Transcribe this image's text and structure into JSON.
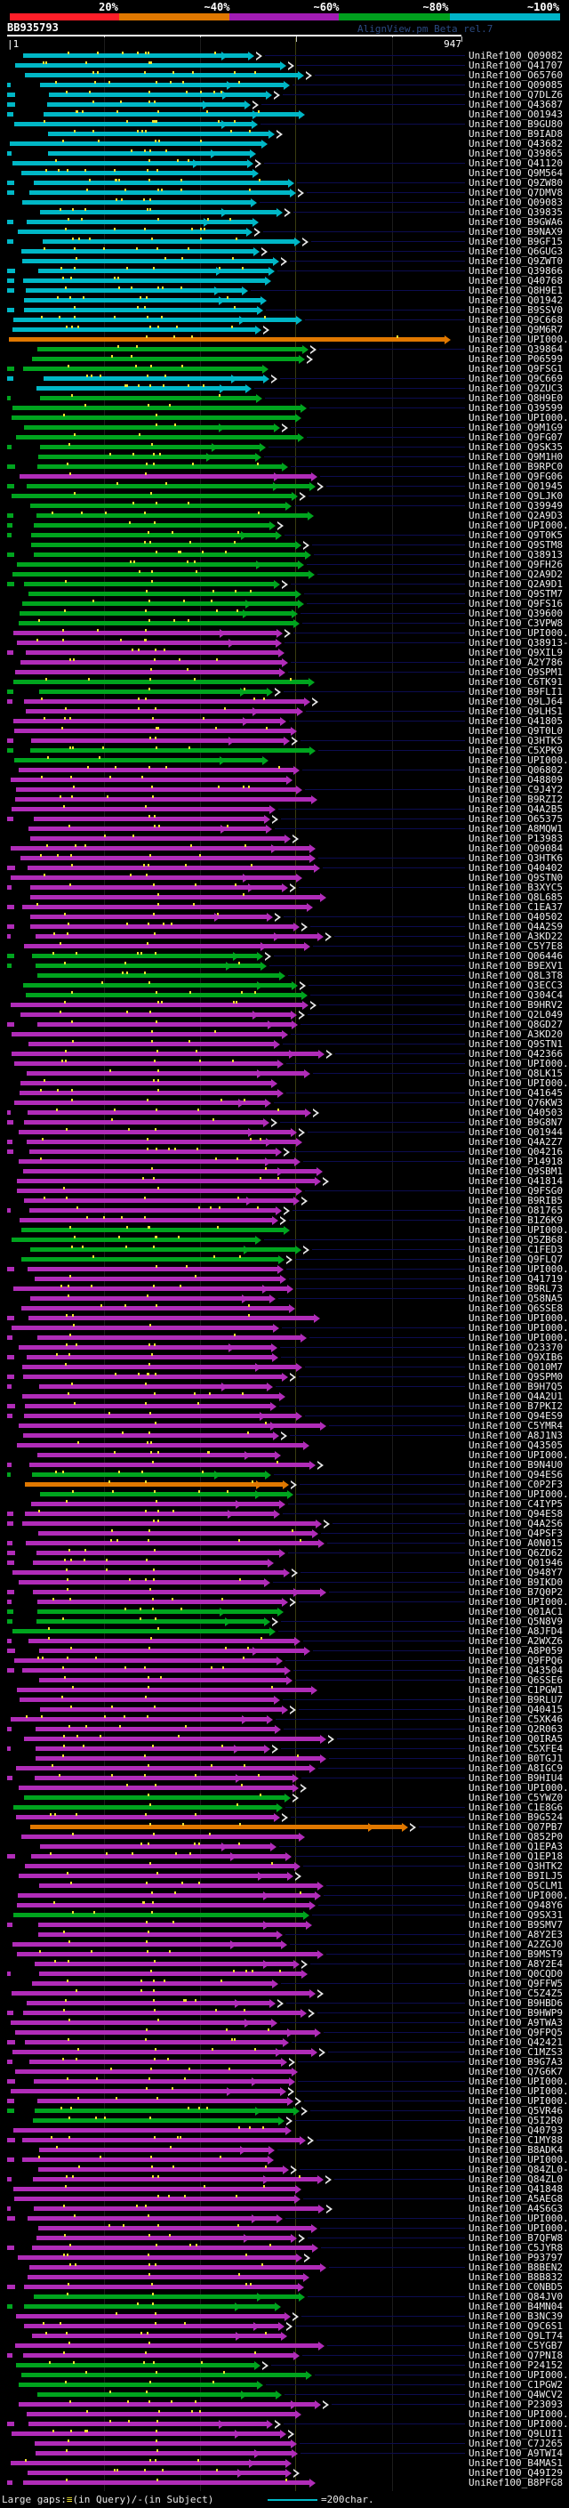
{
  "header": {
    "title": "BB935793",
    "app_label": "AlignView.pm Beta rel.7",
    "query_start_label": "|1",
    "query_end_label": "947"
  },
  "legend": {
    "prefix": "Large gaps:",
    "gap_glyph": "≡",
    "suffix": "(in Query)/-(in Subject)",
    "scalebar_label": "=200char."
  },
  "chart_data": {
    "type": "alignment-map",
    "query": {
      "name": "BB935793",
      "length": 947,
      "start": 1
    },
    "scale": {
      "labels": [
        "20%",
        "~40%",
        "~60%",
        "~80%",
        "~100%"
      ],
      "colors": [
        "#ff1e28",
        "#e07800",
        "#a21cb4",
        "#00a01e",
        "#00b4c8"
      ]
    },
    "bucket_legend": {
      "c": "~100%",
      "g": "~80%",
      "m": "~60%",
      "o": "~40%"
    },
    "hits": [
      [
        "UniRef100_Q09082",
        "c"
      ],
      [
        "UniRef100_Q41707",
        "c"
      ],
      [
        "UniRef100_O65760",
        "c"
      ],
      [
        "UniRef100_Q09085",
        "c"
      ],
      [
        "UniRef100_Q7DLZ6",
        "c"
      ],
      [
        "UniRef100_Q43687",
        "c"
      ],
      [
        "UniRef100_O01943",
        "c"
      ],
      [
        "UniRef100_B9GU80",
        "c"
      ],
      [
        "UniRef100_B9IAD8",
        "c"
      ],
      [
        "UniRef100_Q43682",
        "c"
      ],
      [
        "UniRef100_Q39865",
        "c"
      ],
      [
        "UniRef100_Q41120",
        "c"
      ],
      [
        "UniRef100_Q9M564",
        "c"
      ],
      [
        "UniRef100_Q9ZW80",
        "c"
      ],
      [
        "UniRef100_Q7DMV8",
        "c"
      ],
      [
        "UniRef100_Q09083",
        "c"
      ],
      [
        "UniRef100_Q39835",
        "c"
      ],
      [
        "UniRef100_B9GWA6",
        "c"
      ],
      [
        "UniRef100_B9NAX9",
        "c"
      ],
      [
        "UniRef100_B9GF15",
        "c"
      ],
      [
        "UniRef100_Q6GUG3",
        "c"
      ],
      [
        "UniRef100_Q9ZWT0",
        "c"
      ],
      [
        "UniRef100_Q39866",
        "c"
      ],
      [
        "UniRef100_Q40768",
        "c"
      ],
      [
        "UniRef100_Q8H9E1",
        "c"
      ],
      [
        "UniRef100_Q01942",
        "c"
      ],
      [
        "UniRef100_B9SSV0",
        "c"
      ],
      [
        "UniRef100_Q9C668",
        "c"
      ],
      [
        "UniRef100_Q9M6R7",
        "c"
      ],
      [
        "UniRef100_UPI000..",
        "o"
      ],
      [
        "UniRef100_Q39864",
        "g"
      ],
      [
        "UniRef100_P06599",
        "g"
      ],
      [
        "UniRef100_Q9FSG1",
        "g"
      ],
      [
        "UniRef100_Q9C669",
        "c"
      ],
      [
        "UniRef100_Q9ZUC3",
        "c"
      ],
      [
        "UniRef100_Q8H9E0",
        "g"
      ],
      [
        "UniRef100_Q39599",
        "g"
      ],
      [
        "UniRef100_UPI000..",
        "g"
      ],
      [
        "UniRef100_Q9M1G9",
        "g"
      ],
      [
        "UniRef100_Q9FG07",
        "g"
      ],
      [
        "UniRef100_Q9SK35",
        "g"
      ],
      [
        "UniRef100_Q9M1H0",
        "g"
      ],
      [
        "UniRef100_B9RPC0",
        "g"
      ],
      [
        "UniRef100_Q9FG06",
        "m"
      ],
      [
        "UniRef100_Q01945",
        "g"
      ],
      [
        "UniRef100_Q9LJK0",
        "g"
      ],
      [
        "UniRef100_Q39949",
        "g"
      ],
      [
        "UniRef100_Q2A9D3",
        "g"
      ],
      [
        "UniRef100_UPI000..",
        "g"
      ],
      [
        "UniRef100_Q9T0K5",
        "g"
      ],
      [
        "UniRef100_Q9STM8",
        "g"
      ],
      [
        "UniRef100_Q38913",
        "g"
      ],
      [
        "UniRef100_Q9FH26",
        "g"
      ],
      [
        "UniRef100_Q2A9D2",
        "g"
      ],
      [
        "UniRef100_Q2A9D1",
        "g"
      ],
      [
        "UniRef100_Q9STM7",
        "g"
      ],
      [
        "UniRef100_Q9FS16",
        "g"
      ],
      [
        "UniRef100_Q39600",
        "g"
      ],
      [
        "UniRef100_C3VPW8",
        "g"
      ],
      [
        "UniRef100_UPI000..",
        "m"
      ],
      [
        "UniRef100_Q38913-2",
        "m"
      ],
      [
        "UniRef100_Q9XIL9",
        "m"
      ],
      [
        "UniRef100_A2Y786",
        "m"
      ],
      [
        "UniRef100_Q9SPM1",
        "m"
      ],
      [
        "UniRef100_C6TK91",
        "g"
      ],
      [
        "UniRef100_B9FLI1",
        "g"
      ],
      [
        "UniRef100_Q9LJ64",
        "m"
      ],
      [
        "UniRef100_Q9LHS1",
        "m"
      ],
      [
        "UniRef100_Q41805",
        "m"
      ],
      [
        "UniRef100_Q9T0L0",
        "m"
      ],
      [
        "UniRef100_Q3HTK5",
        "m"
      ],
      [
        "UniRef100_C5XPK9",
        "g"
      ],
      [
        "UniRef100_UPI000..",
        "g"
      ],
      [
        "UniRef100_Q06802",
        "m"
      ],
      [
        "UniRef100_O48809",
        "m"
      ],
      [
        "UniRef100_C9J4Y2",
        "m"
      ],
      [
        "UniRef100_B9RZI2",
        "m"
      ],
      [
        "UniRef100_Q4A2B5",
        "m"
      ],
      [
        "UniRef100_O65375",
        "m"
      ],
      [
        "UniRef100_A8MQW1",
        "m"
      ],
      [
        "UniRef100_P13983",
        "m"
      ],
      [
        "UniRef100_Q09084",
        "m"
      ],
      [
        "UniRef100_Q3HTK6",
        "m"
      ],
      [
        "UniRef100_Q40402",
        "m"
      ],
      [
        "UniRef100_Q9STN0",
        "m"
      ],
      [
        "UniRef100_B3XYC5",
        "m"
      ],
      [
        "UniRef100_Q8L685",
        "m"
      ],
      [
        "UniRef100_C1EA37",
        "m"
      ],
      [
        "UniRef100_Q40502",
        "m"
      ],
      [
        "UniRef100_Q4A2S9",
        "m"
      ],
      [
        "UniRef100_A3KD22",
        "m"
      ],
      [
        "UniRef100_C5Y7E8",
        "m"
      ],
      [
        "UniRef100_Q06446",
        "g"
      ],
      [
        "UniRef100_B9EXV1",
        "g"
      ],
      [
        "UniRef100_Q8L3T8",
        "g"
      ],
      [
        "UniRef100_Q3ECC3",
        "g"
      ],
      [
        "UniRef100_Q304C4",
        "g"
      ],
      [
        "UniRef100_B9HRV2",
        "m"
      ],
      [
        "UniRef100_Q2L049",
        "m"
      ],
      [
        "UniRef100_Q8GD27",
        "m"
      ],
      [
        "UniRef100_A3KD20",
        "m"
      ],
      [
        "UniRef100_Q9STN1",
        "m"
      ],
      [
        "UniRef100_Q42366",
        "m"
      ],
      [
        "UniRef100_UPI000..",
        "m"
      ],
      [
        "UniRef100_Q8LK15",
        "m"
      ],
      [
        "UniRef100_UPI000..",
        "m"
      ],
      [
        "UniRef100_Q41645",
        "m"
      ],
      [
        "UniRef100_Q76KW3",
        "m"
      ],
      [
        "UniRef100_Q40503",
        "m"
      ],
      [
        "UniRef100_B9G8N7",
        "m"
      ],
      [
        "UniRef100_Q01944",
        "m"
      ],
      [
        "UniRef100_Q4A2Z7",
        "m"
      ],
      [
        "UniRef100_Q04216",
        "m"
      ],
      [
        "UniRef100_P14918",
        "m"
      ],
      [
        "UniRef100_Q9SBM1",
        "m"
      ],
      [
        "UniRef100_Q41814",
        "m"
      ],
      [
        "UniRef100_Q9FSG0",
        "m"
      ],
      [
        "UniRef100_B9RIB5",
        "m"
      ],
      [
        "UniRef100_O81765",
        "m"
      ],
      [
        "UniRef100_B1Z6K9",
        "m"
      ],
      [
        "UniRef100_UPI000..",
        "g"
      ],
      [
        "UniRef100_Q5ZB68",
        "g"
      ],
      [
        "UniRef100_C1FED3",
        "g"
      ],
      [
        "UniRef100_Q9FLQ7",
        "g"
      ],
      [
        "UniRef100_UPI000..",
        "m"
      ],
      [
        "UniRef100_Q41719",
        "m"
      ],
      [
        "UniRef100_B9RL73",
        "m"
      ],
      [
        "UniRef100_Q58NA5",
        "m"
      ],
      [
        "UniRef100_Q6SSE8",
        "m"
      ],
      [
        "UniRef100_UPI000..",
        "m"
      ],
      [
        "UniRef100_UPI000..",
        "m"
      ],
      [
        "UniRef100_UPI000..",
        "m"
      ],
      [
        "UniRef100_O23370",
        "m"
      ],
      [
        "UniRef100_Q9XIB6",
        "m"
      ],
      [
        "UniRef100_Q010M7",
        "m"
      ],
      [
        "UniRef100_Q9SPM0",
        "m"
      ],
      [
        "UniRef100_B9H7Q5",
        "m"
      ],
      [
        "UniRef100_Q4A2U1",
        "m"
      ],
      [
        "UniRef100_B7PKI2",
        "m"
      ],
      [
        "UniRef100_Q94ES9",
        "m"
      ],
      [
        "UniRef100_C5YMR4",
        "m"
      ],
      [
        "UniRef100_A8J1N3",
        "m"
      ],
      [
        "UniRef100_Q43505",
        "m"
      ],
      [
        "UniRef100_UPI000..",
        "m"
      ],
      [
        "UniRef100_B9N4U0",
        "m"
      ],
      [
        "UniRef100_Q94ES6",
        "g"
      ],
      [
        "UniRef100_C0P2F3",
        "o"
      ],
      [
        "UniRef100_UPI000..",
        "g"
      ],
      [
        "UniRef100_C4IYP5",
        "m"
      ],
      [
        "UniRef100_Q94ES8",
        "m"
      ],
      [
        "UniRef100_Q4A2S6",
        "m"
      ],
      [
        "UniRef100_Q4PSF3",
        "m"
      ],
      [
        "UniRef100_A0N015",
        "m"
      ],
      [
        "UniRef100_Q6ZD62",
        "m"
      ],
      [
        "UniRef100_Q01946",
        "m"
      ],
      [
        "UniRef100_Q948Y7",
        "m"
      ],
      [
        "UniRef100_B9IKD0",
        "m"
      ],
      [
        "UniRef100_B7Q0P2",
        "m"
      ],
      [
        "UniRef100_UPI000..",
        "m"
      ],
      [
        "UniRef100_Q01AC1",
        "g"
      ],
      [
        "UniRef100_Q5N8V9",
        "g"
      ],
      [
        "UniRef100_A8JFD4",
        "g"
      ],
      [
        "UniRef100_A2WXZ6",
        "m"
      ],
      [
        "UniRef100_A8P059",
        "m"
      ],
      [
        "UniRef100_Q9FPQ6",
        "m"
      ],
      [
        "UniRef100_Q43504",
        "m"
      ],
      [
        "UniRef100_Q6SSE6",
        "m"
      ],
      [
        "UniRef100_C1PGW1",
        "m"
      ],
      [
        "UniRef100_B9RLU7",
        "m"
      ],
      [
        "UniRef100_Q40415",
        "m"
      ],
      [
        "UniRef100_C5XK46",
        "m"
      ],
      [
        "UniRef100_Q2R063",
        "m"
      ],
      [
        "UniRef100_Q0IRA5",
        "m"
      ],
      [
        "UniRef100_C5XFE4",
        "m"
      ],
      [
        "UniRef100_B0TGJ1",
        "m"
      ],
      [
        "UniRef100_A8IGC9",
        "m"
      ],
      [
        "UniRef100_B9HIU4",
        "m"
      ],
      [
        "UniRef100_UPI000..",
        "m"
      ],
      [
        "UniRef100_C5YWZ0",
        "g"
      ],
      [
        "UniRef100_C1E8G6",
        "g"
      ],
      [
        "UniRef100_B9G524",
        "m"
      ],
      [
        "UniRef100_Q07PB7",
        "o"
      ],
      [
        "UniRef100_Q852P0",
        "m"
      ],
      [
        "UniRef100_Q1EPA3",
        "m"
      ],
      [
        "UniRef100_Q1EP18",
        "m"
      ],
      [
        "UniRef100_Q3HTK2",
        "m"
      ],
      [
        "UniRef100_B9ILJ5",
        "m"
      ],
      [
        "UniRef100_Q5CLM1",
        "m"
      ],
      [
        "UniRef100_UPI000..",
        "m"
      ],
      [
        "UniRef100_Q948Y6",
        "m"
      ],
      [
        "UniRef100_Q9SX31",
        "g"
      ],
      [
        "UniRef100_B9SMV7",
        "m"
      ],
      [
        "UniRef100_A8Y2E3",
        "m"
      ],
      [
        "UniRef100_A2ZGJ0",
        "m"
      ],
      [
        "UniRef100_B9MST9",
        "m"
      ],
      [
        "UniRef100_A8Y2E4",
        "m"
      ],
      [
        "UniRef100_Q0CQD0",
        "m"
      ],
      [
        "UniRef100_Q9FFW5",
        "m"
      ],
      [
        "UniRef100_C5Z4Z5",
        "m"
      ],
      [
        "UniRef100_B9HBD6",
        "m"
      ],
      [
        "UniRef100_B9HWP9",
        "m"
      ],
      [
        "UniRef100_A9TWA3",
        "m"
      ],
      [
        "UniRef100_Q9FPQ5",
        "m"
      ],
      [
        "UniRef100_Q42421",
        "m"
      ],
      [
        "UniRef100_C1MZS3",
        "m"
      ],
      [
        "UniRef100_B9G7A3",
        "m"
      ],
      [
        "UniRef100_Q7G6K7",
        "m"
      ],
      [
        "UniRef100_UPI000..",
        "m"
      ],
      [
        "UniRef100_UPI000..",
        "m"
      ],
      [
        "UniRef100_UPI000..",
        "m"
      ],
      [
        "UniRef100_Q5VR46",
        "g"
      ],
      [
        "UniRef100_Q5I2R0",
        "g"
      ],
      [
        "UniRef100_Q40793",
        "m"
      ],
      [
        "UniRef100_C1MY88",
        "m"
      ],
      [
        "UniRef100_B8ADK4",
        "m"
      ],
      [
        "UniRef100_UPI000..",
        "m"
      ],
      [
        "UniRef100_Q84ZL0-2",
        "m"
      ],
      [
        "UniRef100_Q84ZL0",
        "m"
      ],
      [
        "UniRef100_Q41848",
        "m"
      ],
      [
        "UniRef100_A5AEG8",
        "m"
      ],
      [
        "UniRef100_A4S6G3",
        "m"
      ],
      [
        "UniRef100_UPI000..",
        "m"
      ],
      [
        "UniRef100_UPI000..",
        "m"
      ],
      [
        "UniRef100_B7QFW8",
        "m"
      ],
      [
        "UniRef100_C5JYR8",
        "m"
      ],
      [
        "UniRef100_P93797",
        "m"
      ],
      [
        "UniRef100_B8BEN2",
        "m"
      ],
      [
        "UniRef100_B8B832",
        "m"
      ],
      [
        "UniRef100_C0NBD5",
        "m"
      ],
      [
        "UniRef100_Q84JV0",
        "g"
      ],
      [
        "UniRef100_B4MN04",
        "g"
      ],
      [
        "UniRef100_B3NC39",
        "m"
      ],
      [
        "UniRef100_Q9C6S1",
        "m"
      ],
      [
        "UniRef100_Q9LT74",
        "m"
      ],
      [
        "UniRef100_C5YGB7",
        "m"
      ],
      [
        "UniRef100_Q7PNI8",
        "m"
      ],
      [
        "UniRef100_P24152",
        "g"
      ],
      [
        "UniRef100_UPI000..",
        "g"
      ],
      [
        "UniRef100_C1PGW2",
        "g"
      ],
      [
        "UniRef100_Q4WCV2",
        "g"
      ],
      [
        "UniRef100_P23093",
        "m"
      ],
      [
        "UniRef100_UPI000..",
        "m"
      ],
      [
        "UniRef100_UPI000..",
        "m"
      ],
      [
        "UniRef100_Q9LUI1",
        "m"
      ],
      [
        "UniRef100_C7J265",
        "m"
      ],
      [
        "UniRef100_A9TWI4",
        "m"
      ],
      [
        "UniRef100_B4MAS1",
        "m"
      ],
      [
        "UniRef100_Q49I29",
        "m"
      ],
      [
        "UniRef100_B8PFG8",
        "m"
      ]
    ]
  }
}
